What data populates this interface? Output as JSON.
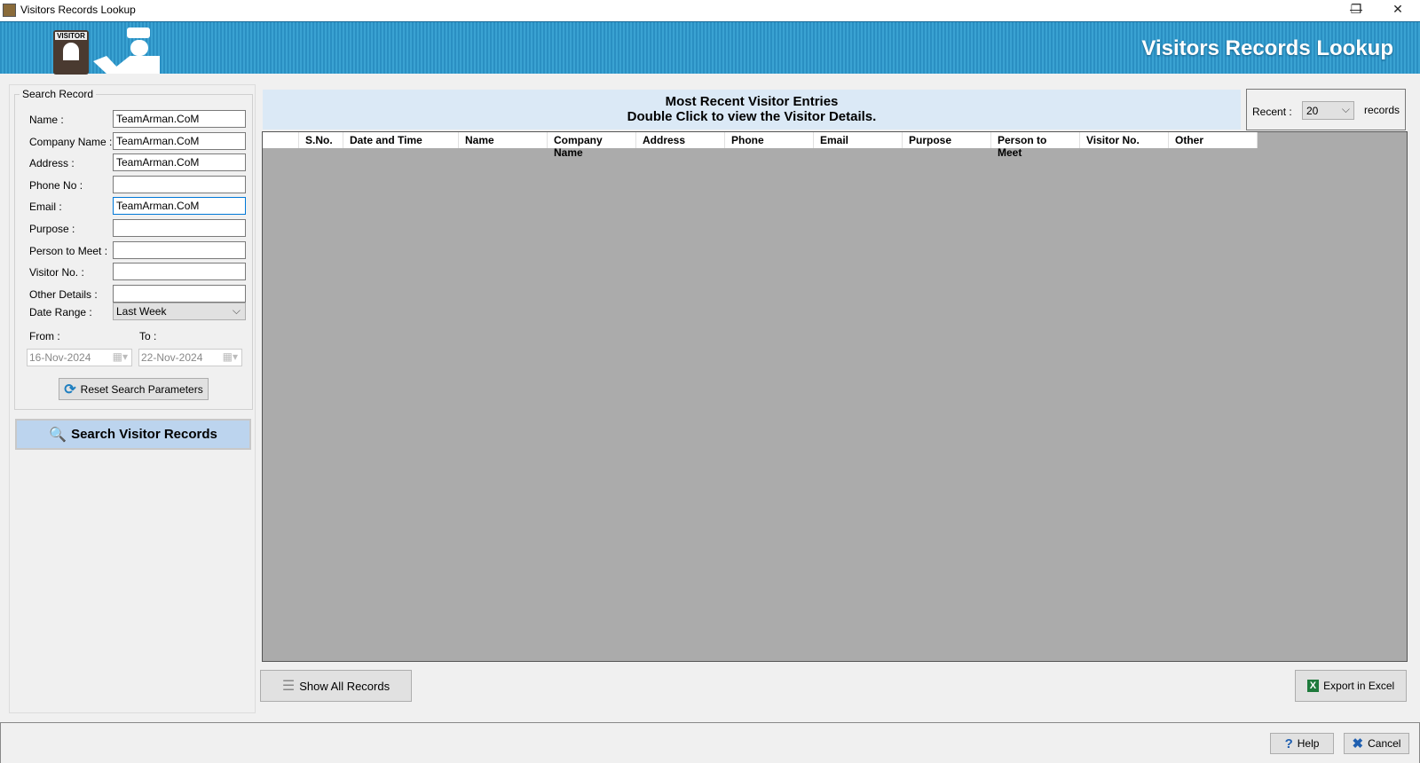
{
  "window": {
    "title": "Visitors Records Lookup",
    "minimize": "—",
    "restore": "❐",
    "close": "✕"
  },
  "banner": {
    "title": "Visitors Records Lookup",
    "badge_text": "VISITOR"
  },
  "search": {
    "group_title": "Search Record",
    "fields": [
      {
        "label": "Name :",
        "value": "TeamArman.CoM"
      },
      {
        "label": "Company Name :",
        "value": "TeamArman.CoM"
      },
      {
        "label": "Address :",
        "value": "TeamArman.CoM"
      },
      {
        "label": "Phone No :",
        "value": ""
      },
      {
        "label": "Email :",
        "value": "TeamArman.CoM"
      },
      {
        "label": "Purpose :",
        "value": ""
      },
      {
        "label": "Person to Meet :",
        "value": ""
      },
      {
        "label": "Visitor No. :",
        "value": ""
      },
      {
        "label": "Other Details :",
        "value": ""
      }
    ],
    "date_range_label": "Date Range :",
    "date_range_value": "Last Week",
    "from_label": "From :",
    "to_label": "To :",
    "from_value": "16-Nov-2024",
    "to_value": "22-Nov-2024",
    "reset_label": "Reset Search Parameters",
    "search_label": "Search Visitor Records"
  },
  "main": {
    "heading1": "Most Recent Visitor Entries",
    "heading2": "Double Click to view the Visitor Details.",
    "recent_label": "Recent :",
    "recent_value": "20",
    "records_label": "records",
    "columns": [
      "S.No.",
      "Date and Time",
      "Name",
      "Company Name",
      "Address",
      "Phone",
      "Email",
      "Purpose",
      "Person to Meet",
      "Visitor No.",
      "Other"
    ],
    "show_all_label": "Show All Records",
    "export_label": "Export in Excel"
  },
  "footer": {
    "help_label": "Help",
    "cancel_label": "Cancel"
  },
  "colors": {
    "banner": "#3aa2d2",
    "search_button": "#bcd4ee",
    "header_band": "#dbe9f6",
    "grid_bg": "#ababab"
  }
}
